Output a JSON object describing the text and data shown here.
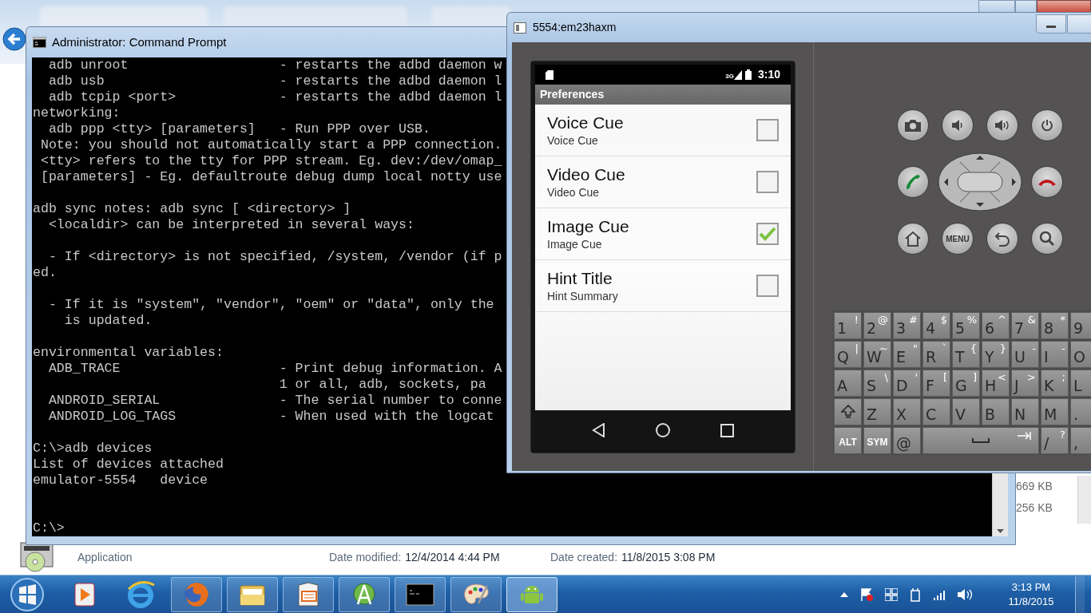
{
  "explorer": {
    "file_sizes": [
      "669 KB",
      "256 KB"
    ],
    "details": {
      "type": "Application",
      "modified_label": "Date modified:",
      "modified": "12/4/2014 4:44 PM",
      "created_label": "Date created:",
      "created": "11/8/2015 3:08 PM"
    }
  },
  "console": {
    "title": "Administrator: Command Prompt",
    "paragraphs": [
      [
        "  adb unroot                   - restarts the adbd daemon w",
        "  adb usb                      - restarts the adbd daemon l",
        "  adb tcpip <port>             - restarts the adbd daemon l",
        "networking:",
        "  adb ppp <tty> [parameters]   - Run PPP over USB.",
        " Note: you should not automatically start a PPP connection.",
        " <tty> refers to the tty for PPP stream. Eg. dev:/dev/omap_",
        " [parameters] - Eg. defaultroute debug dump local notty use"
      ],
      [
        "adb sync notes: adb sync [ <directory> ]",
        "  <localdir> can be interpreted in several ways:"
      ],
      [
        "  - If <directory> is not specified, /system, /vendor (if p",
        "ed."
      ],
      [
        "  - If it is \"system\", \"vendor\", \"oem\" or \"data\", only the",
        "    is updated."
      ],
      [
        "environmental variables:",
        "  ADB_TRACE                    - Print debug information. A",
        "                               1 or all, adb, sockets, pa",
        "  ANDROID_SERIAL               - The serial number to conne",
        "  ANDROID_LOG_TAGS             - When used with the logcat"
      ],
      [
        "C:\\>adb devices",
        "List of devices attached",
        "emulator-5554   device"
      ]
    ],
    "prompt": "C:\\>"
  },
  "emulator": {
    "title": "5554:em23haxm",
    "status_bar": {
      "network": "3G",
      "time": "3:10"
    },
    "action_bar": {
      "title": "Preferences"
    },
    "preferences": [
      {
        "title": "Voice Cue",
        "summary": "Voice Cue",
        "checked": false
      },
      {
        "title": "Video Cue",
        "summary": "Video Cue",
        "checked": false
      },
      {
        "title": "Image Cue",
        "summary": "Image Cue",
        "checked": true
      },
      {
        "title": "Hint Title",
        "summary": "Hint Summary",
        "checked": false
      }
    ],
    "menu_key": "MENU",
    "keyboard": [
      [
        {
          "kind": "char",
          "label": "1",
          "alt": "!"
        },
        {
          "kind": "char",
          "label": "2",
          "alt": "@"
        },
        {
          "kind": "char",
          "label": "3",
          "alt": "#"
        },
        {
          "kind": "char",
          "label": "4",
          "alt": "$"
        },
        {
          "kind": "char",
          "label": "5",
          "alt": "%"
        },
        {
          "kind": "char",
          "label": "6",
          "alt": "^"
        },
        {
          "kind": "char",
          "label": "7",
          "alt": "&"
        },
        {
          "kind": "char",
          "label": "8",
          "alt": "*"
        },
        {
          "kind": "char",
          "label": "9"
        }
      ],
      [
        {
          "kind": "char",
          "label": "Q",
          "alt": "|"
        },
        {
          "kind": "char",
          "label": "W",
          "alt": "~"
        },
        {
          "kind": "char",
          "label": "E",
          "alt": "\""
        },
        {
          "kind": "char",
          "label": "R",
          "alt": "`"
        },
        {
          "kind": "char",
          "label": "T",
          "alt": "{"
        },
        {
          "kind": "char",
          "label": "Y",
          "alt": "}"
        },
        {
          "kind": "char",
          "label": "U",
          "alt": "-"
        },
        {
          "kind": "char",
          "label": "I",
          "alt": "-"
        },
        {
          "kind": "char",
          "label": "O"
        }
      ],
      [
        {
          "kind": "char",
          "label": "A"
        },
        {
          "kind": "char",
          "label": "S",
          "alt": "\\"
        },
        {
          "kind": "char",
          "label": "D",
          "alt": "'"
        },
        {
          "kind": "char",
          "label": "F",
          "alt": "["
        },
        {
          "kind": "char",
          "label": "G",
          "alt": "]"
        },
        {
          "kind": "char",
          "label": "H",
          "alt": "<"
        },
        {
          "kind": "char",
          "label": "J",
          "alt": ">"
        },
        {
          "kind": "char",
          "label": "K",
          "alt": ";"
        },
        {
          "kind": "char",
          "label": "L"
        }
      ],
      [
        {
          "kind": "shift"
        },
        {
          "kind": "char",
          "label": "Z"
        },
        {
          "kind": "char",
          "label": "X"
        },
        {
          "kind": "char",
          "label": "C"
        },
        {
          "kind": "char",
          "label": "V"
        },
        {
          "kind": "char",
          "label": "B"
        },
        {
          "kind": "char",
          "label": "N"
        },
        {
          "kind": "char",
          "label": "M"
        },
        {
          "kind": "char",
          "label": "."
        }
      ],
      [
        {
          "kind": "mod",
          "label": "ALT"
        },
        {
          "kind": "mod",
          "label": "SYM"
        },
        {
          "kind": "char",
          "label": "@"
        },
        {
          "kind": "space"
        },
        {
          "kind": "char",
          "label": "/",
          "alt": "?"
        },
        {
          "kind": "char",
          "label": ","
        }
      ]
    ]
  },
  "taskbar": {
    "clock": {
      "time": "3:13 PM",
      "date": "11/8/2015"
    }
  }
}
